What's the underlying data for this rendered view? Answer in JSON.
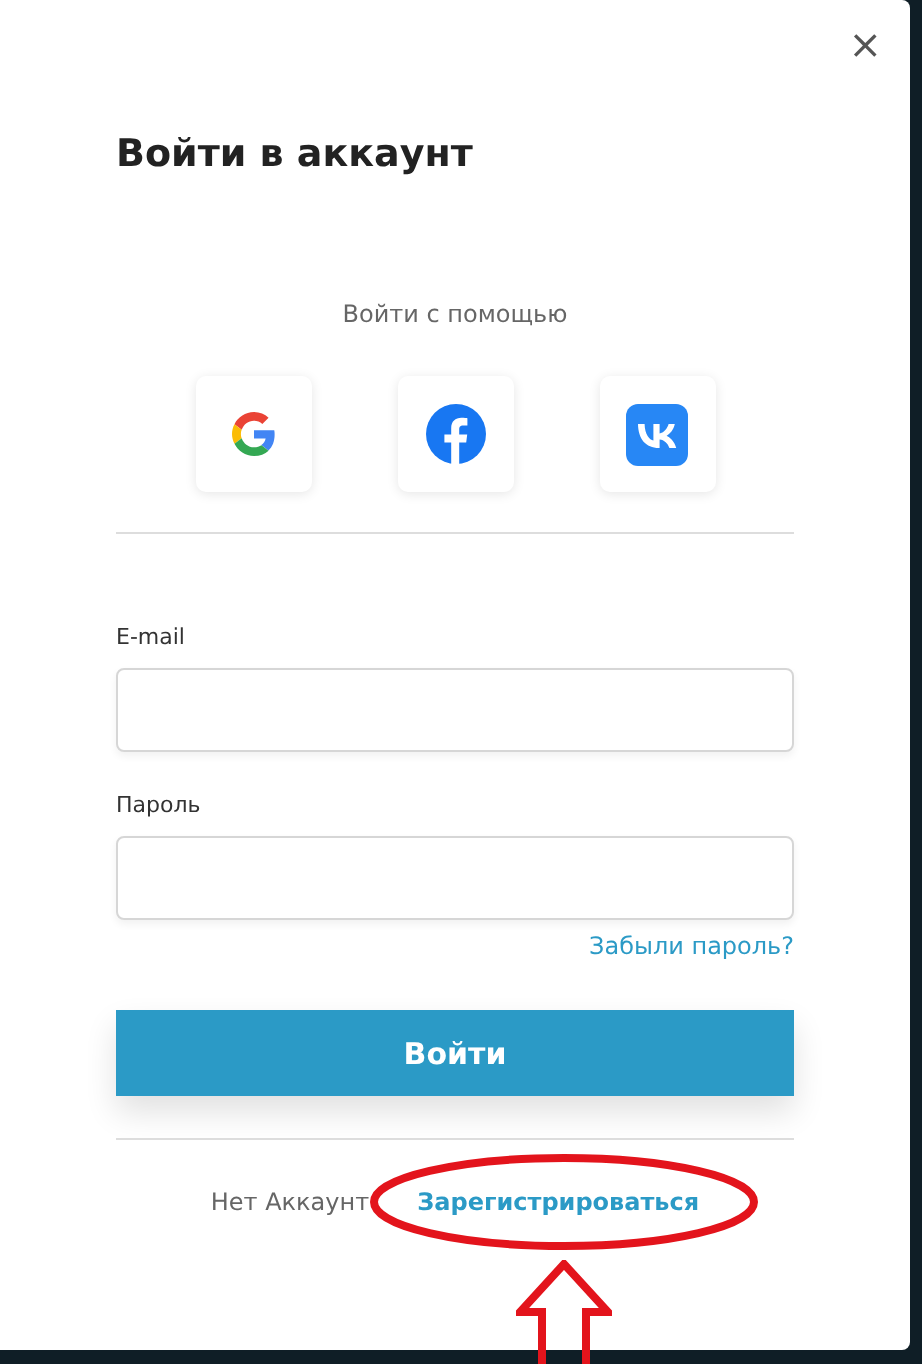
{
  "dialog": {
    "title": "Войти в аккаунт",
    "close": "×"
  },
  "social": {
    "caption": "Войти с помощью",
    "providers": [
      {
        "kind": "google"
      },
      {
        "kind": "facebook"
      },
      {
        "kind": "vk"
      }
    ]
  },
  "fields": [
    {
      "label": "E-mail"
    },
    {
      "label": "Пароль"
    }
  ],
  "forgot_link": "Забыли пароль?",
  "submit": "Войти",
  "footer": {
    "text": "Нет Аккаунт",
    "link": "Зарегистрироваться"
  }
}
